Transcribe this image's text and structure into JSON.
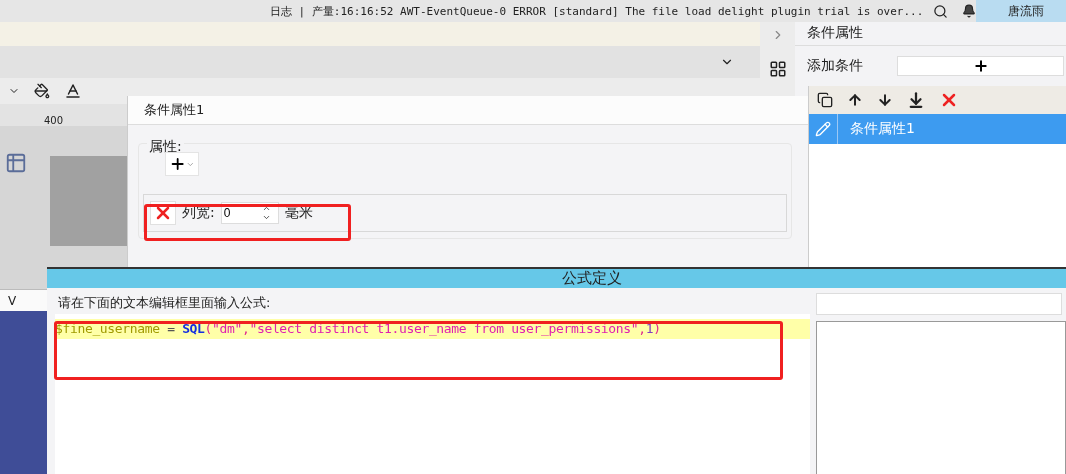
{
  "status_bar": {
    "log_text": "日志 | 产量:16:16:52 AWT-EventQueue-0 ERROR [standard] The file load delight plugin trial is over...",
    "user": "唐流雨"
  },
  "designer": {
    "ruler_mark": "400",
    "column_header": "V"
  },
  "condition_dialog": {
    "title": "条件属性1",
    "section_label": "属性:",
    "rows": [
      {
        "label": "列宽:",
        "value": "0",
        "unit": "毫米"
      }
    ]
  },
  "right_panel": {
    "title": "条件属性",
    "add_label": "添加条件",
    "items": [
      {
        "label": "条件属性1",
        "selected": true
      }
    ]
  },
  "formula_dialog": {
    "title": "公式定义",
    "prompt": "请在下面的文本编辑框里面输入公式:",
    "tokens": [
      {
        "kind": "variable",
        "text": "$fine_username"
      },
      {
        "kind": "operator",
        "text": " = "
      },
      {
        "kind": "function",
        "text": "SQL"
      },
      {
        "kind": "punct",
        "text": "("
      },
      {
        "kind": "string",
        "text": "\"dm\""
      },
      {
        "kind": "punct",
        "text": ","
      },
      {
        "kind": "string",
        "text": "\"select distinct t1.user_name from user_permissions\""
      },
      {
        "kind": "punct",
        "text": ","
      },
      {
        "kind": "number",
        "text": "1"
      },
      {
        "kind": "punct",
        "text": ")"
      }
    ]
  }
}
